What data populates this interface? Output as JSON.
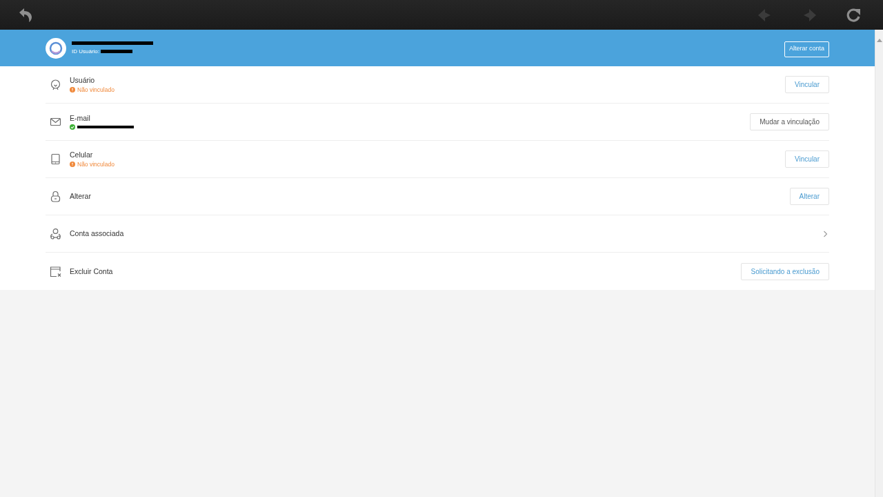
{
  "toolbar": {
    "buttons": [
      {
        "kind": "back",
        "disabled": false
      },
      {
        "kind": "previous",
        "disabled": true
      },
      {
        "kind": "next",
        "disabled": true
      },
      {
        "kind": "reload",
        "disabled": false
      }
    ]
  },
  "account_header": {
    "name_redacted": true,
    "id_label": "ID Usuário:",
    "id_redacted": true,
    "button": "Alterar conta"
  },
  "rows": [
    {
      "title": "Usuário",
      "status": {
        "kind": "warning",
        "text": "Não vinculado"
      },
      "action": {
        "kind": "button",
        "label": "Vincular",
        "highlighted": true
      }
    },
    {
      "title": "E-mail",
      "status": {
        "kind": "ok",
        "redacted": true
      },
      "action": {
        "kind": "button",
        "label": "Mudar a vinculação",
        "highlighted": false
      }
    },
    {
      "title": "Celular",
      "status": {
        "kind": "warning",
        "text": "Não vinculado"
      },
      "action": {
        "kind": "button",
        "label": "Vincular",
        "highlighted": true
      }
    },
    {
      "title": "Alterar",
      "action": {
        "kind": "button",
        "label": "Alterar",
        "highlighted": true
      }
    },
    {
      "title": "Conta associada",
      "action": {
        "kind": "chevron"
      }
    },
    {
      "title": "Excluir Conta",
      "action": {
        "kind": "button",
        "label": "Solicitando a exclusão",
        "highlighted": true
      }
    }
  ]
}
